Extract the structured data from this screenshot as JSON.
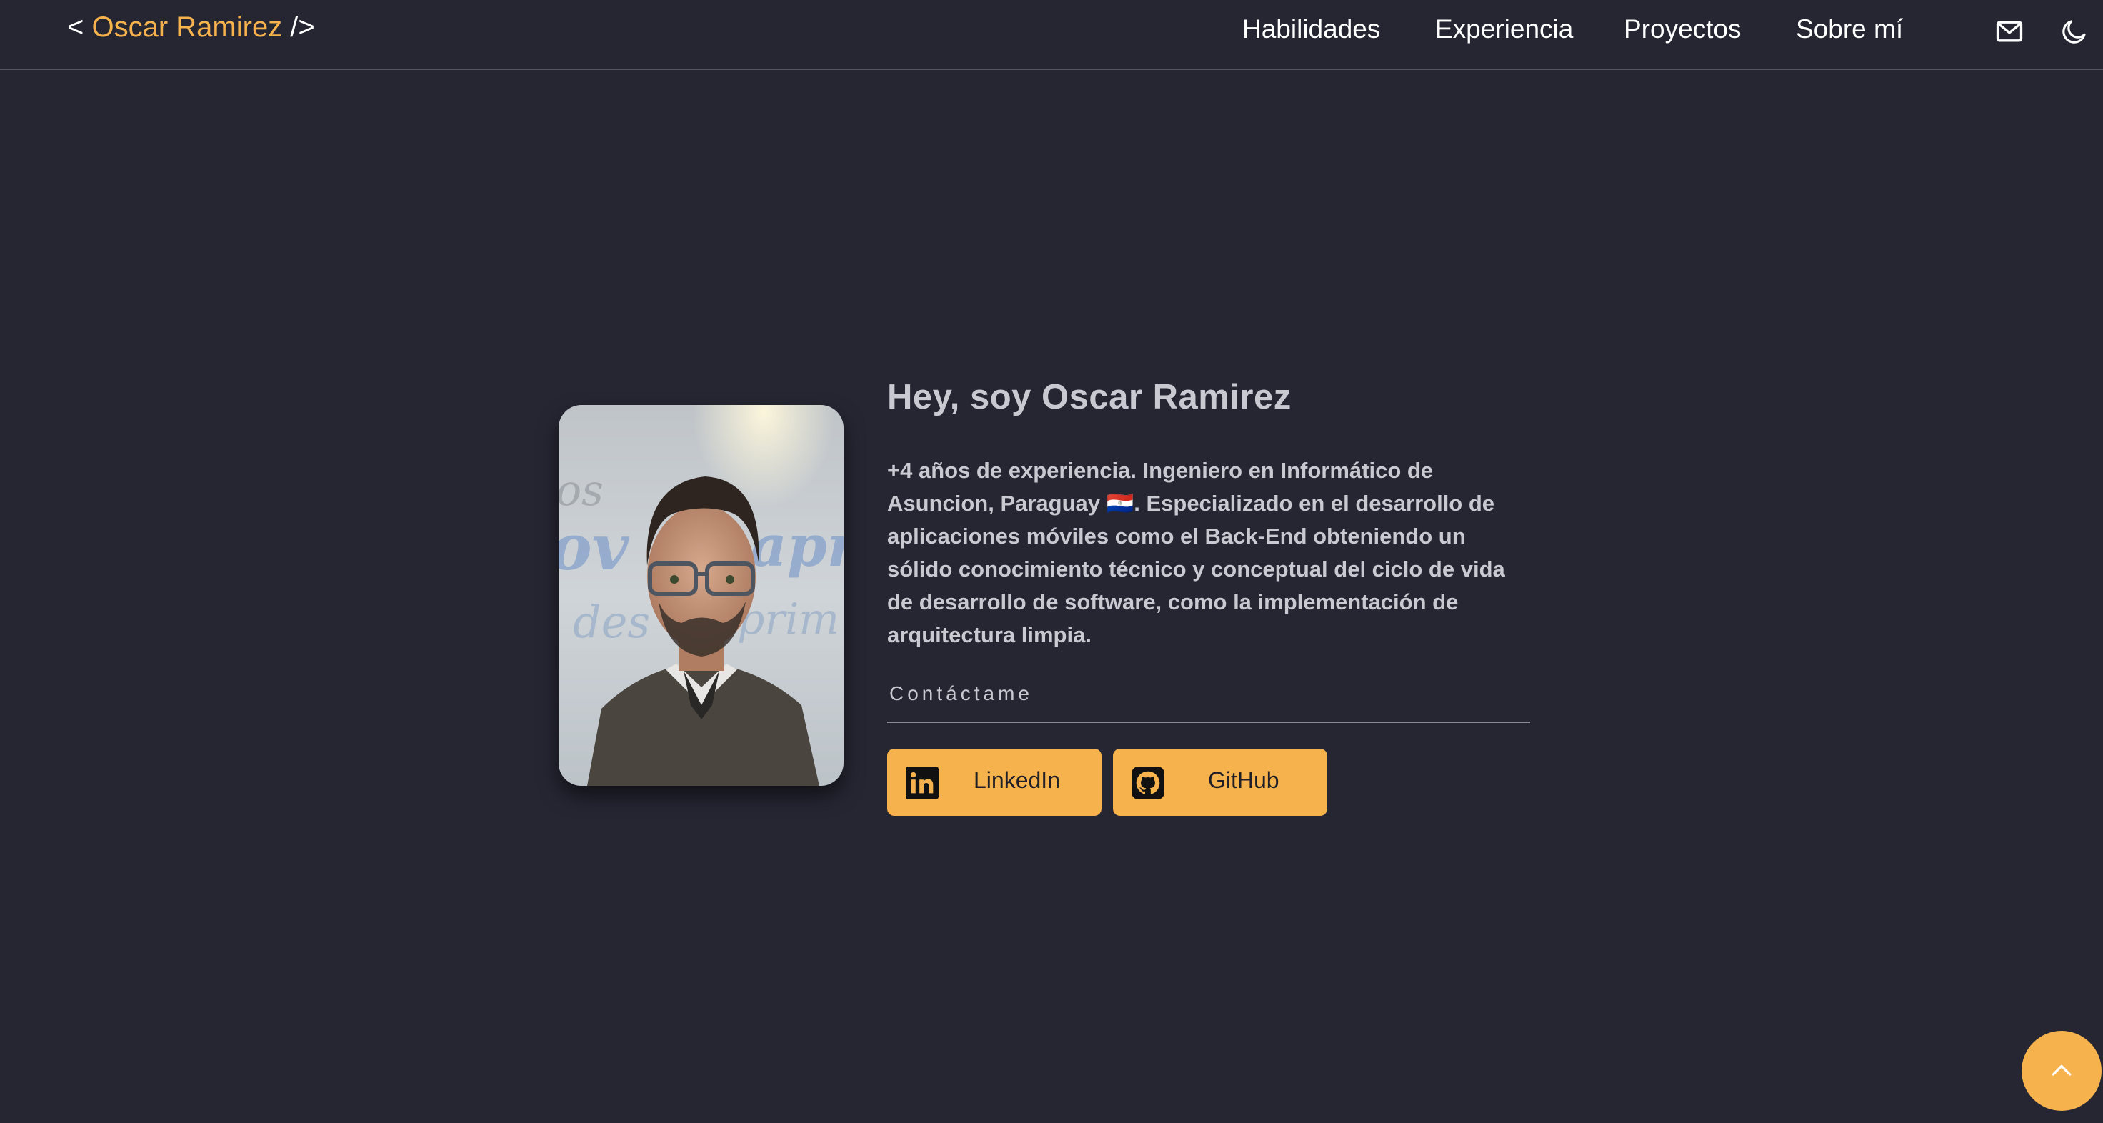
{
  "header": {
    "logo_open": "< ",
    "logo_name": "Oscar Ramirez",
    "logo_close": " />",
    "nav": [
      {
        "label": "Habilidades"
      },
      {
        "label": "Experiencia"
      },
      {
        "label": "Proyectos"
      },
      {
        "label": "Sobre mí"
      }
    ],
    "icons": {
      "mail": "mail-icon",
      "theme": "moon-icon"
    }
  },
  "hero": {
    "title": "Hey, soy Oscar Ramirez",
    "description": "+4 años de experiencia. Ingeniero en Informático de Asuncion, Paraguay 🇵🇾. Especializado en el desarrollo de aplicaciones móviles como el Back-End obteniendo un sólido conocimiento técnico y conceptual del ciclo de vida de desarrollo de software, como la implementación de arquitectura limpia.",
    "contact_label": "Contáctame",
    "buttons": [
      {
        "label": "LinkedIn",
        "icon": "linkedin-icon"
      },
      {
        "label": "GitHub",
        "icon": "github-icon"
      }
    ]
  },
  "colors": {
    "background": "#262633",
    "accent": "#f6b34d",
    "text": "#c9c9d1"
  },
  "scroll_top": {
    "icon": "chevron-up-icon"
  }
}
